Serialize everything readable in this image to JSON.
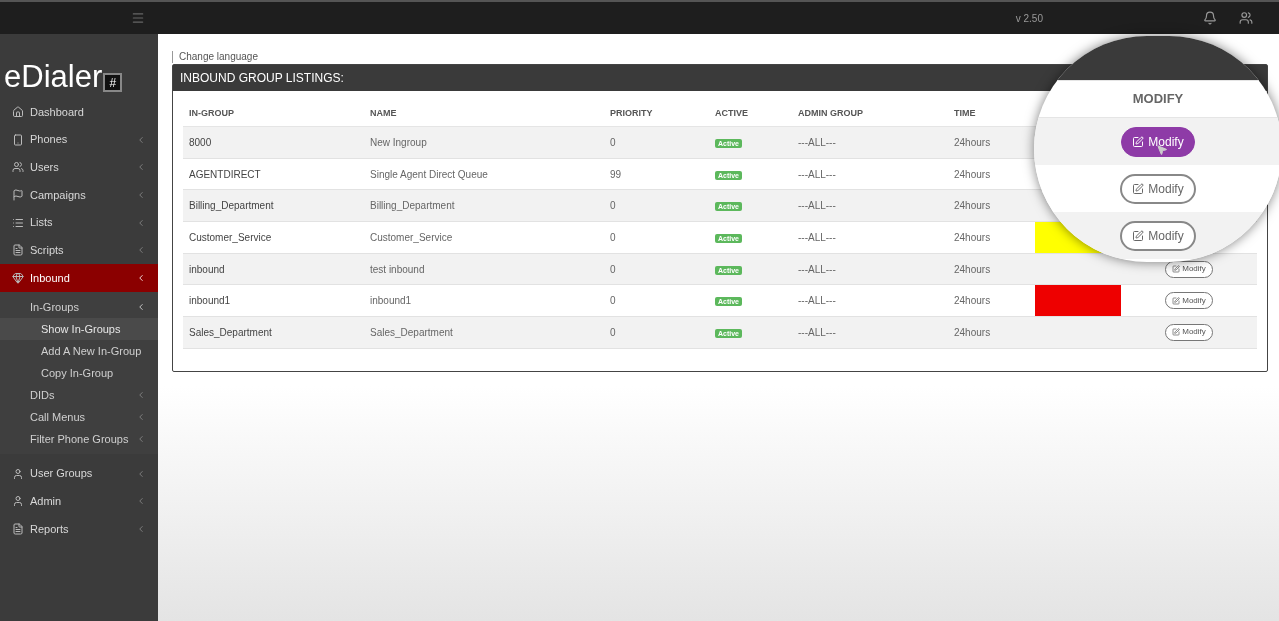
{
  "topbar": {
    "version": "v 2.50"
  },
  "sidebar": {
    "logo": {
      "text": "eDialer",
      "mark": "#"
    },
    "items": [
      {
        "label": "Dashboard",
        "selected": false,
        "has_submenu": false
      },
      {
        "label": "Phones",
        "selected": false,
        "has_submenu": true
      },
      {
        "label": "Users",
        "selected": false,
        "has_submenu": true
      },
      {
        "label": "Campaigns",
        "selected": false,
        "has_submenu": true
      },
      {
        "label": "Lists",
        "selected": false,
        "has_submenu": true
      },
      {
        "label": "Scripts",
        "selected": false,
        "has_submenu": true
      },
      {
        "label": "Inbound",
        "selected": true,
        "has_submenu": true,
        "expanded": true,
        "children": [
          {
            "label": "In-Groups",
            "selected": false,
            "has_submenu": true,
            "expanded": true,
            "children": [
              {
                "label": "Show In-Groups",
                "selected": true
              },
              {
                "label": "Add A New In-Group",
                "selected": false
              },
              {
                "label": "Copy In-Group",
                "selected": false
              }
            ]
          },
          {
            "label": "DIDs",
            "selected": false,
            "has_submenu": true,
            "expanded": false
          },
          {
            "label": "Call Menus",
            "selected": false,
            "has_submenu": true,
            "expanded": false
          },
          {
            "label": "Filter Phone Groups",
            "selected": false,
            "has_submenu": true,
            "expanded": false
          }
        ]
      },
      {
        "label": "User Groups",
        "selected": false,
        "has_submenu": true
      },
      {
        "label": "Admin",
        "selected": false,
        "has_submenu": true
      },
      {
        "label": "Reports",
        "selected": false,
        "has_submenu": true
      }
    ]
  },
  "change_language": "Change language",
  "panel": {
    "title": "INBOUND GROUP LISTINGS:",
    "table": {
      "columns": [
        "IN-GROUP",
        "NAME",
        "PRIORITY",
        "ACTIVE",
        "ADMIN GROUP",
        "TIME"
      ],
      "rows": [
        {
          "in_group": "8000",
          "name": "New Ingroup",
          "priority": "0",
          "active": "Active",
          "admin_group": "---ALL---",
          "time": "24hours"
        },
        {
          "in_group": "AGENTDIRECT",
          "name": "Single Agent Direct Queue",
          "priority": "99",
          "active": "Active",
          "admin_group": "---ALL---",
          "time": "24hours"
        },
        {
          "in_group": "Billing_Department",
          "name": "Billing_Department",
          "priority": "0",
          "active": "Active",
          "admin_group": "---ALL---",
          "time": "24hours"
        },
        {
          "in_group": "Customer_Service",
          "name": "Customer_Service",
          "priority": "0",
          "active": "Active",
          "admin_group": "---ALL---",
          "time": "24hours",
          "color": "#ffff00"
        },
        {
          "in_group": "inbound",
          "name": "test inbound",
          "priority": "0",
          "active": "Active",
          "admin_group": "---ALL---",
          "time": "24hours",
          "modify": "Modify"
        },
        {
          "in_group": "inbound1",
          "name": "inbound1",
          "priority": "0",
          "active": "Active",
          "admin_group": "---ALL---",
          "time": "24hours",
          "color": "#ee0000",
          "modify": "Modify"
        },
        {
          "in_group": "Sales_Department",
          "name": "Sales_Department",
          "priority": "0",
          "active": "Active",
          "admin_group": "---ALL---",
          "time": "24hours",
          "modify": "Modify"
        }
      ]
    }
  },
  "magnifier": {
    "header": "MODIFY",
    "buttons": [
      {
        "label": "Modify",
        "hovered": true
      },
      {
        "label": "Modify",
        "hovered": false
      },
      {
        "label": "Modify",
        "hovered": false
      }
    ]
  }
}
